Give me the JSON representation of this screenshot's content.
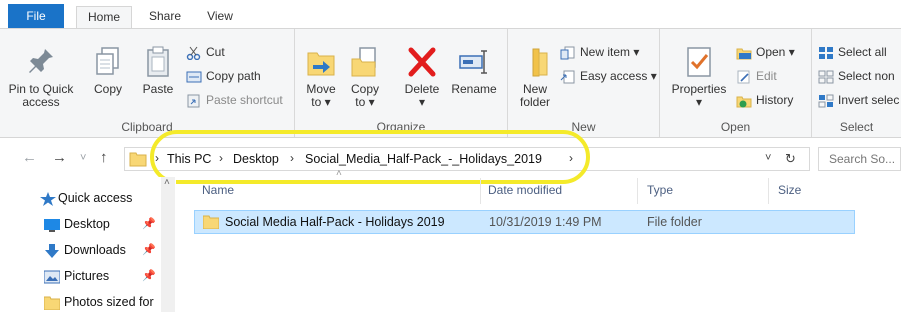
{
  "tabs": {
    "file": "File",
    "home": "Home",
    "share": "Share",
    "view": "View"
  },
  "ribbon": {
    "clipboard": {
      "label": "Clipboard",
      "pin_line1": "Pin to Quick",
      "pin_line2": "access",
      "copy": "Copy",
      "paste": "Paste",
      "cut": "Cut",
      "copy_path": "Copy path",
      "paste_shortcut": "Paste shortcut"
    },
    "organize": {
      "label": "Organize",
      "move_line1": "Move",
      "move_line2": "to",
      "copy_line1": "Copy",
      "copy_line2": "to",
      "delete": "Delete",
      "rename": "Rename"
    },
    "new": {
      "label": "New",
      "folder_line1": "New",
      "folder_line2": "folder",
      "new_item": "New item",
      "easy_access": "Easy access"
    },
    "open": {
      "label": "Open",
      "properties": "Properties",
      "open": "Open",
      "edit": "Edit",
      "history": "History"
    },
    "select": {
      "label": "Select",
      "select_all": "Select all",
      "select_none": "Select non",
      "invert": "Invert selec"
    }
  },
  "address": {
    "crumbs": [
      "This PC",
      "Desktop",
      "Social_Media_Half-Pack_-_Holidays_2019"
    ],
    "search_placeholder": "Search So..."
  },
  "nav": {
    "items": [
      {
        "label": "Quick access"
      },
      {
        "label": "Desktop"
      },
      {
        "label": "Downloads"
      },
      {
        "label": "Pictures"
      },
      {
        "label": "Photos sized for"
      }
    ]
  },
  "columns": {
    "name": "Name",
    "date": "Date modified",
    "type": "Type",
    "size": "Size"
  },
  "files": [
    {
      "name": "Social Media Half-Pack - Holidays 2019",
      "date": "10/31/2019 1:49 PM",
      "type": "File folder",
      "size": ""
    }
  ],
  "colors": {
    "accent": "#1a73c8",
    "highlight": "#f4ea2a",
    "selection": "#cce8ff",
    "folder": "#f8d775"
  }
}
